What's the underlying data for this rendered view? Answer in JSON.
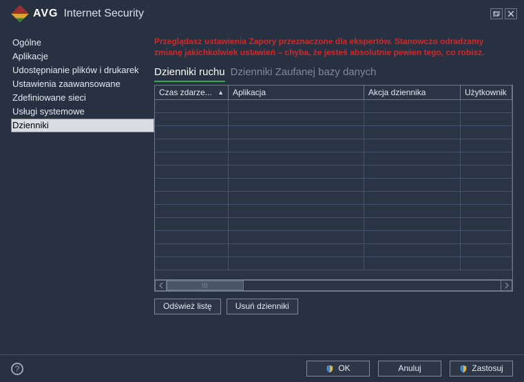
{
  "header": {
    "brand": "AVG",
    "app_title": "Internet Security"
  },
  "window_controls": {
    "restore_tooltip": "Maximize/Restore",
    "close_tooltip": "Close"
  },
  "sidebar": {
    "items": [
      {
        "label": "Ogólne"
      },
      {
        "label": "Aplikacje"
      },
      {
        "label": "Udostępnianie plików i drukarek"
      },
      {
        "label": "Ustawienia zaawansowane"
      },
      {
        "label": "Zdefiniowane sieci"
      },
      {
        "label": "Usługi systemowe"
      },
      {
        "label": "Dzienniki"
      }
    ],
    "selected_index": 6
  },
  "main": {
    "warning_text": "Przeglądasz ustawienia Zapory przeznaczone dla ekspertów. Stanowczo odradzamy zmianę jakichkolwiek ustawień – chyba, że jesteś absolutnie pewien tego, co robisz.",
    "tabs": [
      {
        "label": "Dzienniki ruchu",
        "active": true
      },
      {
        "label": "Dzienniki Zaufanej bazy danych",
        "active": false
      }
    ],
    "table": {
      "columns": [
        {
          "label": "Czas zdarze...",
          "sorted": "asc"
        },
        {
          "label": "Aplikacja"
        },
        {
          "label": "Akcja dziennika"
        },
        {
          "label": "Użytkownik"
        }
      ],
      "rows": []
    },
    "buttons": {
      "refresh_label": "Odśwież listę",
      "clear_label": "Usuń dzienniki"
    }
  },
  "footer": {
    "ok_label": "OK",
    "cancel_label": "Anuluj",
    "apply_label": "Zastosuj"
  },
  "colors": {
    "background": "#273142",
    "warning_text": "#cc2a2a",
    "active_tab_underline": "#2fa84f",
    "border": "#6e7a8c"
  }
}
